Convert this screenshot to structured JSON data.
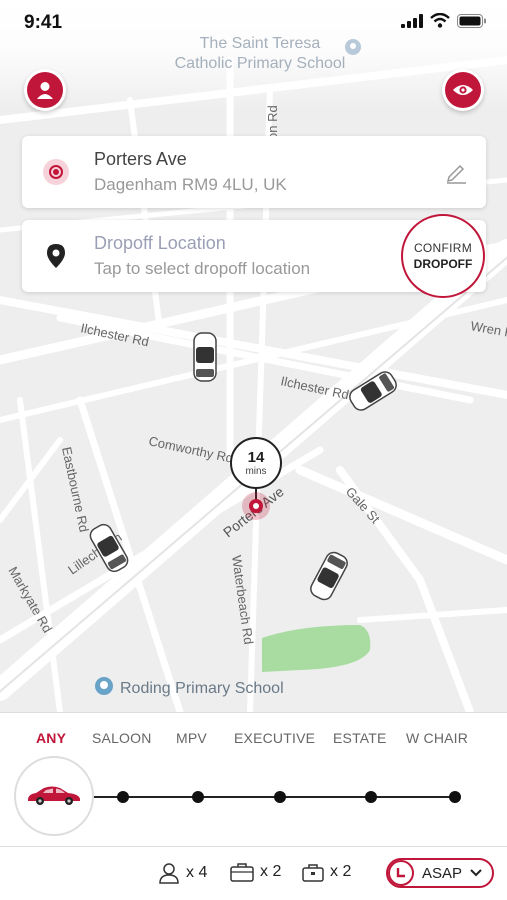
{
  "status_bar": {
    "time": "9:41"
  },
  "map": {
    "poi_top": {
      "line1": "The Saint Teresa",
      "line2": "Catholic Primary School"
    },
    "poi_bottom": "Roding Primary School",
    "streets": {
      "ilchester_1": "Ilchester Rd",
      "ilchester_2": "Ilchester Rd",
      "comworthy": "Comworthy Rd",
      "porters": "Porters Ave",
      "gale": "Gale St",
      "wren": "Wren R",
      "eastbourne": "Eastbourne Rd",
      "markyate": "Markyate Rd",
      "lillechurch": "Lillechurch",
      "waterbeach": "Waterbeach Rd",
      "top_road": "on Rd"
    }
  },
  "pickup": {
    "title": "Porters Ave",
    "subtitle": "Dagenham RM9 4LU, UK"
  },
  "dropoff": {
    "title": "Dropoff Location",
    "subtitle": "Tap to select dropoff location"
  },
  "confirm": {
    "line1": "CONFIRM",
    "line2": "DROPOFF"
  },
  "eta": {
    "value": "14",
    "unit": "mins"
  },
  "vehicle_tabs": [
    {
      "label": "ANY",
      "active": true
    },
    {
      "label": "SALOON",
      "active": false
    },
    {
      "label": "MPV",
      "active": false
    },
    {
      "label": "EXECUTIVE",
      "active": false
    },
    {
      "label": "ESTATE",
      "active": false
    },
    {
      "label": "W CHAIR",
      "active": false
    }
  ],
  "footer": {
    "passengers": "x 4",
    "luggage": "x 2",
    "hand_luggage": "x 2",
    "asap": "ASAP"
  },
  "colors": {
    "accent": "#c0163a",
    "park": "#a8dca0",
    "road": "#ffffff",
    "map_bg": "#eeeeee"
  },
  "icons": [
    "user-icon",
    "eye-icon",
    "pickup-target-icon",
    "pencil-icon",
    "location-pin-icon",
    "car-icon",
    "person-icon",
    "suitcase-icon",
    "briefcase-icon",
    "clock-icon",
    "chevron-down-icon"
  ]
}
